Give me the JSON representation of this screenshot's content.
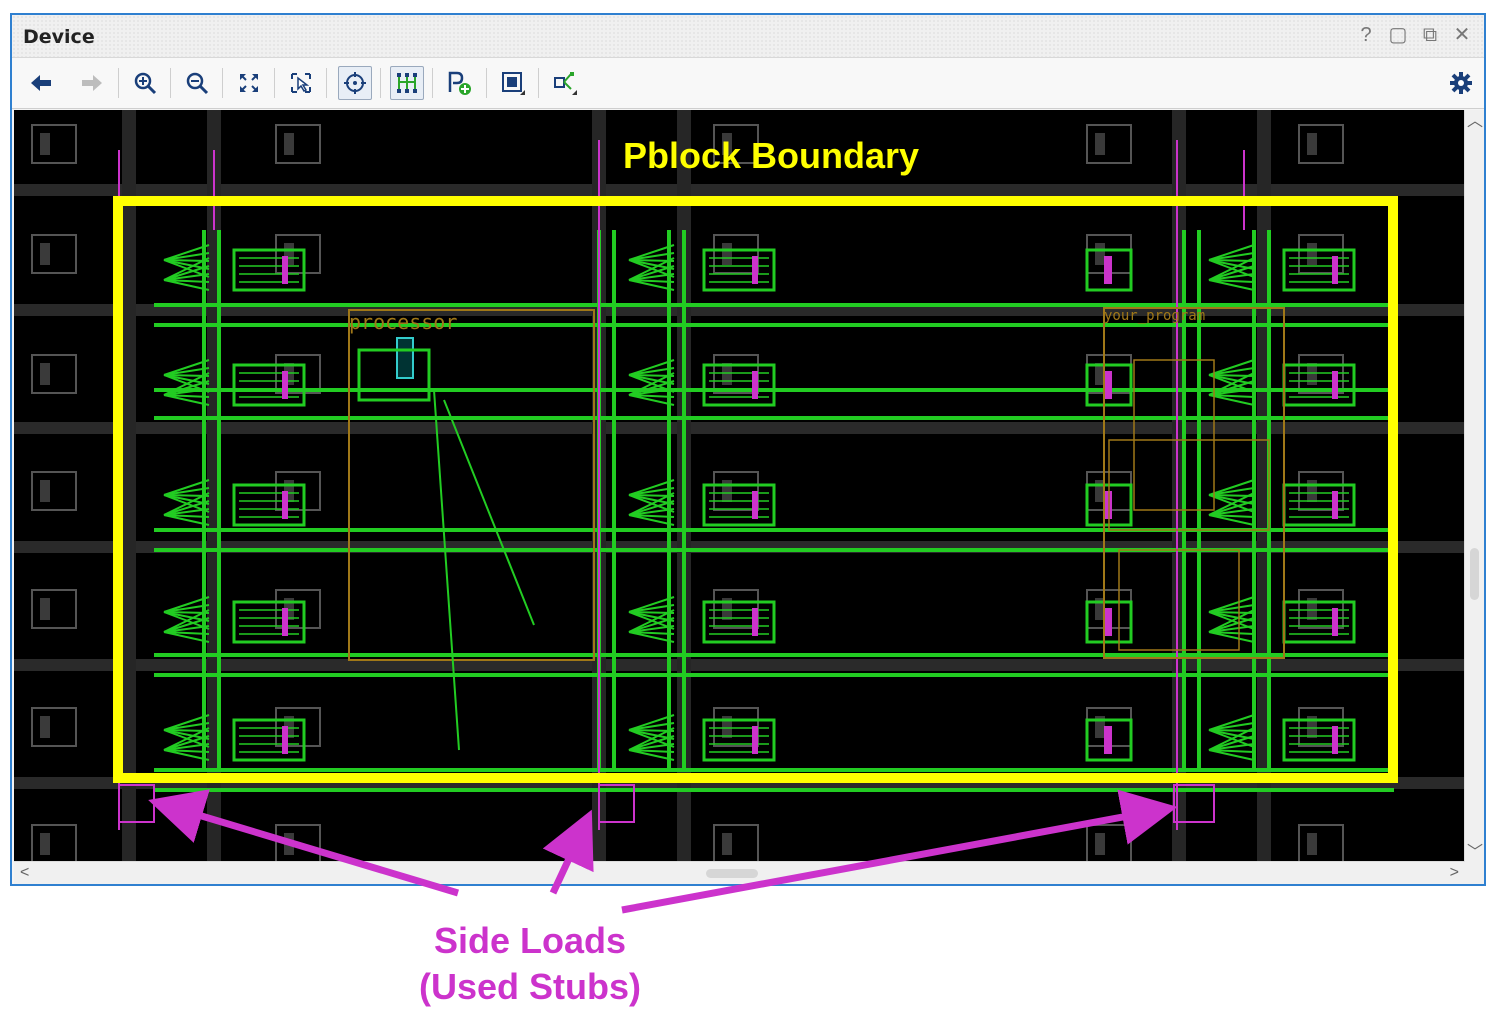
{
  "window": {
    "title": "Device",
    "controls": [
      {
        "name": "help",
        "glyph": "?"
      },
      {
        "name": "restore",
        "glyph": "▢"
      },
      {
        "name": "float",
        "glyph": "⧉"
      },
      {
        "name": "close",
        "glyph": "✕"
      }
    ]
  },
  "toolbar": {
    "buttons": [
      {
        "name": "back",
        "icon": "arrow-left-icon"
      },
      {
        "name": "forward",
        "icon": "arrow-right-icon"
      },
      {
        "name": "zoom-in",
        "icon": "zoom-in-icon"
      },
      {
        "name": "zoom-out",
        "icon": "zoom-out-icon"
      },
      {
        "name": "zoom-fit",
        "icon": "zoom-fit-icon"
      },
      {
        "name": "zoom-selection",
        "icon": "zoom-selection-icon"
      },
      {
        "name": "auto-fit-selection",
        "icon": "crosshair-icon"
      },
      {
        "name": "routing-resources",
        "icon": "routing-icon"
      },
      {
        "name": "draw-pblock",
        "icon": "pblock-add-icon"
      },
      {
        "name": "site-select",
        "icon": "site-icon"
      },
      {
        "name": "nets",
        "icon": "nets-icon"
      },
      {
        "name": "settings",
        "icon": "gear-icon"
      }
    ]
  },
  "device_view": {
    "cell_labels": [
      "processor",
      "your_program"
    ],
    "colors": {
      "background": "#000000",
      "routed_nets": "#22cc22",
      "side_loads": "#cc33cc",
      "pblock": "#ffff00",
      "cell_outline": "#a07818"
    }
  },
  "annotations": {
    "pblock_label": "Pblock Boundary",
    "side_loads_line1": "Side Loads",
    "side_loads_line2": "(Used Stubs)"
  }
}
